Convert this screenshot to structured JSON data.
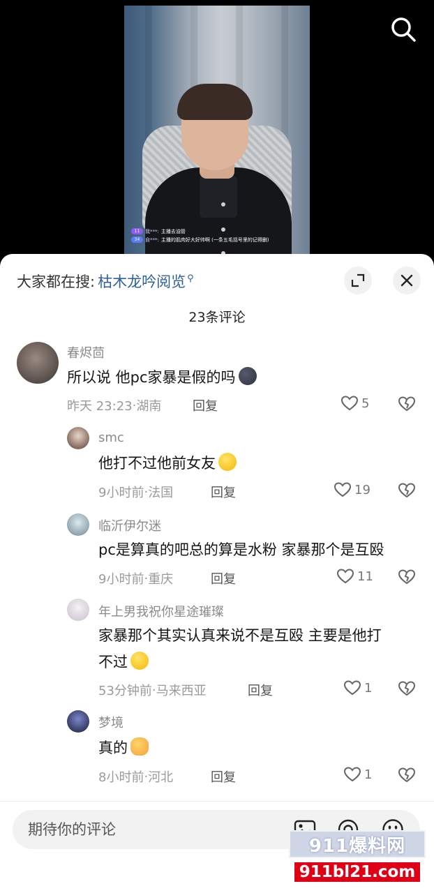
{
  "live_overlay": {
    "comments": [
      {
        "badge": "11",
        "user": "我***:",
        "text": "主播去油管"
      },
      {
        "badge": "34",
        "user": "自***:",
        "text": "主播的肌肉好大好帅啊 (一条五毛括号里的记得删)"
      }
    ]
  },
  "icons": {
    "search": "search-icon",
    "expand": "expand-icon",
    "close": "close-icon",
    "like": "heart-icon",
    "dislike": "broken-heart-icon",
    "image": "image-icon",
    "mention": "at-icon",
    "emoji": "emoji-icon"
  },
  "sheet": {
    "hot_search_label": "大家都在搜:",
    "hot_search_keyword": "枯木龙吟阅览",
    "comment_count": "23条评论"
  },
  "comments": [
    {
      "user": "春烬茴",
      "text": "所以说 他pc家暴是假的吗",
      "emoji": "cloud",
      "time": "昨天 23:23",
      "location": "湖南",
      "reply": "回复",
      "likes": "5"
    },
    {
      "user": "smc",
      "text": "他打不过他前女友",
      "emoji": "laugh",
      "time": "9小时前",
      "location": "法国",
      "reply": "回复",
      "likes": "19"
    },
    {
      "user": "临沂伊尔迷",
      "text": "pc是算真的吧总的算是水粉 家暴那个是互殴",
      "time": "9小时前",
      "location": "重庆",
      "reply": "回复",
      "likes": "11"
    },
    {
      "user": "年上男我祝你星途璀璨",
      "text_line1": "家暴那个其实认真来说不是互殴 主要是他打",
      "text_line2": "不过",
      "emoji": "laugh",
      "time": "53分钟前",
      "location": "马来西亚",
      "reply": "回复",
      "likes": "1"
    },
    {
      "user": "梦境",
      "text": "真的",
      "emoji": "hug",
      "time": "8小时前",
      "location": "河北",
      "reply": "回复",
      "likes": "1"
    }
  ],
  "meta_separator": " · ",
  "input": {
    "placeholder": "期待你的评论"
  },
  "watermark": {
    "top": "911爆料网",
    "bottom": "911bl21.com"
  },
  "colors": {
    "keyword": "#2d5f9a",
    "watermark_red": "#e00016"
  }
}
